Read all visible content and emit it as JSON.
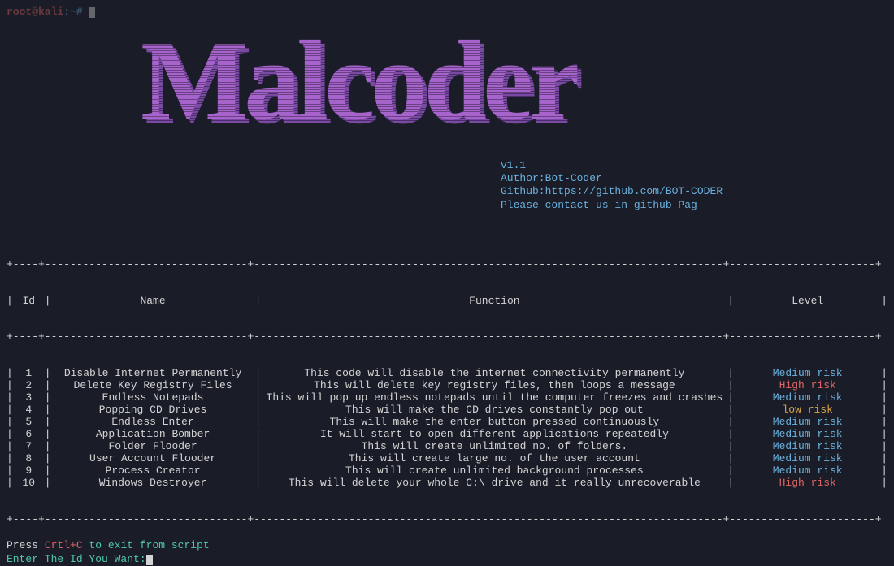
{
  "prompt": {
    "user_host": "root@kali",
    "path": ":~#",
    "cursor": "█"
  },
  "banner": {
    "text": "Malcoder"
  },
  "meta": {
    "version": "v1.1",
    "author": "Author:Bot-Coder",
    "github": "Github:https://github.com/BOT-CODER",
    "contact": "Please contact us in github Pag"
  },
  "table": {
    "headers": {
      "id": "Id",
      "name": "Name",
      "func": "Function",
      "level": "Level"
    },
    "rows": [
      {
        "id": "1",
        "name": "Disable Internet Permanently",
        "func": "This code will disable the internet connectivity permanently",
        "level": "Medium risk",
        "risk": "medium"
      },
      {
        "id": "2",
        "name": "Delete Key Registry Files",
        "func": "This will delete key registry files, then loops a message",
        "level": "High risk",
        "risk": "high"
      },
      {
        "id": "3",
        "name": "Endless Notepads",
        "func": "This will pop up endless notepads until the computer freezes and crashes",
        "level": "Medium risk",
        "risk": "medium"
      },
      {
        "id": "4",
        "name": "Popping CD Drives",
        "func": "This will make the CD drives constantly pop out",
        "level": "low risk",
        "risk": "low"
      },
      {
        "id": "5",
        "name": "Endless Enter",
        "func": "This will make the enter button pressed continuously",
        "level": "Medium risk",
        "risk": "medium"
      },
      {
        "id": "6",
        "name": "Application Bomber",
        "func": "It will start to open different applications repeatedly",
        "level": "Medium risk",
        "risk": "medium"
      },
      {
        "id": "7",
        "name": "Folder Flooder",
        "func": "This will create unlimited no. of folders.",
        "level": "Medium risk",
        "risk": "medium"
      },
      {
        "id": "8",
        "name": "User Account Flooder",
        "func": "This will create large no. of the user account",
        "level": "Medium risk",
        "risk": "medium"
      },
      {
        "id": "9",
        "name": "Process Creator",
        "func": "This will create unlimited background processes",
        "level": "Medium risk",
        "risk": "medium"
      },
      {
        "id": "10",
        "name": "Windows Destroyer",
        "func": "This will delete your whole C:\\ drive and it really unrecoverable",
        "level": "High risk",
        "risk": "high"
      }
    ]
  },
  "footer": {
    "press": "Press",
    "ctrlc": "Crtl+C",
    "exit": "to exit from script",
    "enter_prompt": "Enter The Id You Want:"
  }
}
